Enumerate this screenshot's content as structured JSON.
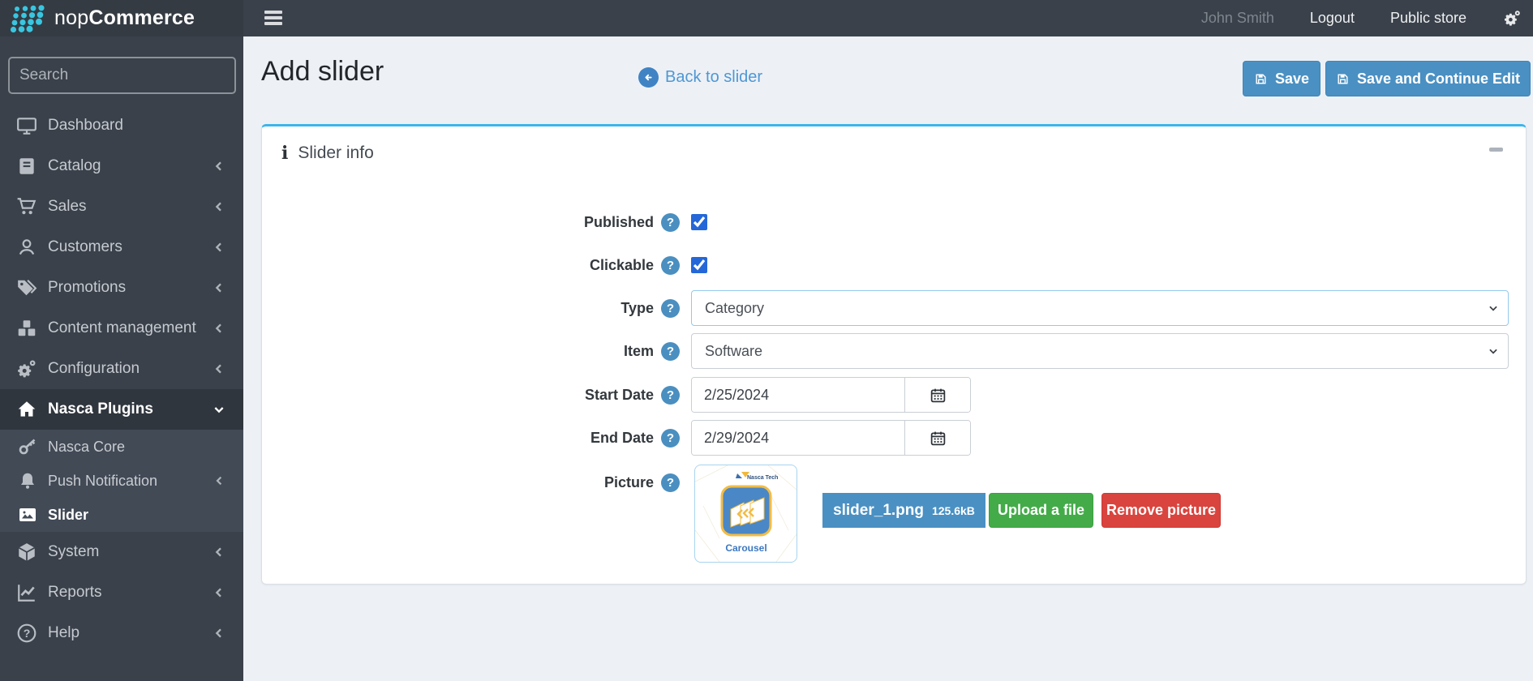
{
  "header": {
    "brand_prefix": "nop",
    "brand_suffix": "Commerce",
    "user_name": "John Smith",
    "logout": "Logout",
    "public_store": "Public store"
  },
  "sidebar": {
    "search_placeholder": "Search",
    "items": [
      {
        "label": "Dashboard"
      },
      {
        "label": "Catalog"
      },
      {
        "label": "Sales"
      },
      {
        "label": "Customers"
      },
      {
        "label": "Promotions"
      },
      {
        "label": "Content management"
      },
      {
        "label": "Configuration"
      },
      {
        "label": "Nasca Plugins"
      },
      {
        "label": "Nasca Core"
      },
      {
        "label": "Push Notification"
      },
      {
        "label": "Slider"
      },
      {
        "label": "System"
      },
      {
        "label": "Reports"
      },
      {
        "label": "Help"
      }
    ]
  },
  "page": {
    "title": "Add slider",
    "back_link": "Back to slider",
    "save_label": "Save",
    "save_continue_label": "Save and Continue Edit"
  },
  "panel": {
    "title": "Slider info",
    "fields": {
      "published": {
        "label": "Published",
        "checked": true
      },
      "clickable": {
        "label": "Clickable",
        "checked": true
      },
      "type": {
        "label": "Type",
        "value": "Category"
      },
      "item": {
        "label": "Item",
        "value": "Software"
      },
      "start_date": {
        "label": "Start Date",
        "value": "2/25/2024"
      },
      "end_date": {
        "label": "End Date",
        "value": "2/29/2024"
      },
      "picture": {
        "label": "Picture",
        "file_name": "slider_1.png",
        "file_size": "125.6kB",
        "upload_label": "Upload a file",
        "remove_label": "Remove picture",
        "thumb_brand": "Nasca Tech",
        "thumb_caption": "Carousel"
      }
    }
  },
  "colors": {
    "accent_blue": "#4a90c3",
    "panel_top": "#3db5e9",
    "success_green": "#44ab49",
    "danger_red": "#d9443e",
    "sidebar_bg": "#3a414a",
    "logo_dots": "#38c6e0"
  }
}
